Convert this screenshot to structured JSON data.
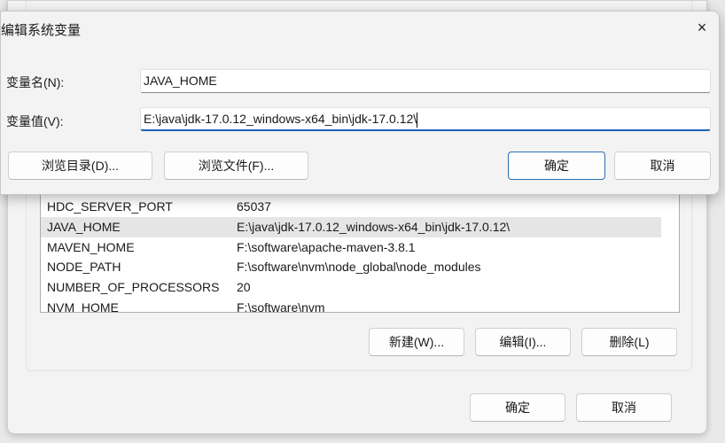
{
  "edit_dialog": {
    "title": "编辑系统变量",
    "name_label": "变量名(N):",
    "value_label": "变量值(V):",
    "name_value": "JAVA_HOME",
    "value_value": "E:\\java\\jdk-17.0.12_windows-x64_bin\\jdk-17.0.12\\",
    "browse_dir": "浏览目录(D)...",
    "browse_file": "浏览文件(F)...",
    "ok": "确定",
    "cancel": "取消",
    "close_icon": "×"
  },
  "env_dialog": {
    "variables": [
      {
        "name": "HDC_SERVER_PORT",
        "value": "65037"
      },
      {
        "name": "JAVA_HOME",
        "value": "E:\\java\\jdk-17.0.12_windows-x64_bin\\jdk-17.0.12\\"
      },
      {
        "name": "MAVEN_HOME",
        "value": "F:\\software\\apache-maven-3.8.1"
      },
      {
        "name": "NODE_PATH",
        "value": "F:\\software\\nvm\\node_global\\node_modules"
      },
      {
        "name": "NUMBER_OF_PROCESSORS",
        "value": "20"
      },
      {
        "name": "NVM_HOME",
        "value": "F:\\software\\nvm"
      }
    ],
    "new": "新建(W)...",
    "edit": "编辑(I)...",
    "delete": "删除(L)",
    "ok": "确定",
    "cancel": "取消"
  }
}
